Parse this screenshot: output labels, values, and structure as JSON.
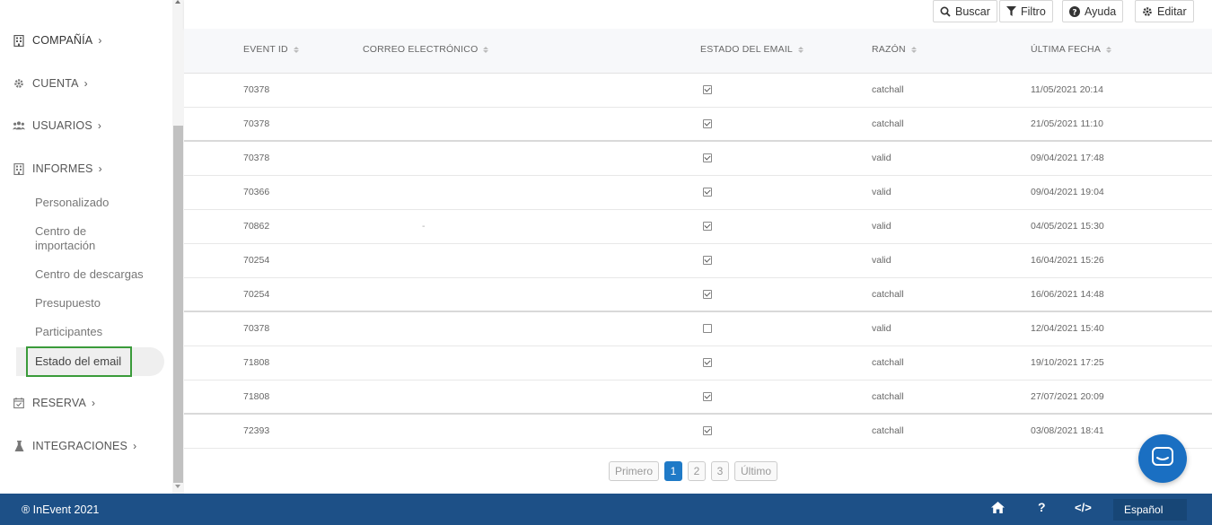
{
  "sidebar": {
    "sections": [
      {
        "label": "COMPAÑÍA",
        "icon": "building-icon"
      },
      {
        "label": "CUENTA",
        "icon": "gear-icon"
      },
      {
        "label": "USUARIOS",
        "icon": "users-icon"
      },
      {
        "label": "INFORMES",
        "icon": "building-icon"
      },
      {
        "label": "RESERVA",
        "icon": "calendar-check-icon"
      },
      {
        "label": "INTEGRACIONES",
        "icon": "flask-icon"
      }
    ],
    "chevron": "›",
    "report_items": [
      {
        "label": "Personalizado"
      },
      {
        "label": "Centro de\nimportación"
      },
      {
        "label": "Centro de descargas"
      },
      {
        "label": "Presupuesto"
      },
      {
        "label": "Participantes"
      },
      {
        "label": "Estado del email"
      }
    ]
  },
  "toolbar": {
    "search_label": "Buscar",
    "filter_label": "Filtro",
    "help_label": "Ayuda",
    "edit_label": "Editar"
  },
  "table": {
    "headers": [
      "EVENT ID",
      "CORREO ELECTRÓNICO",
      "ESTADO DEL EMAIL",
      "RAZÓN",
      "ÚLTIMA FECHA"
    ],
    "rows": [
      {
        "event_id": "70378",
        "email": "",
        "status": true,
        "reason": "catchall",
        "date": "11/05/2021 20:14"
      },
      {
        "event_id": "70378",
        "email": "",
        "status": true,
        "reason": "catchall",
        "date": "21/05/2021 11:10"
      },
      {
        "event_id": "70378",
        "email": "",
        "status": true,
        "reason": "valid",
        "date": "09/04/2021 17:48"
      },
      {
        "event_id": "70366",
        "email": "",
        "status": true,
        "reason": "valid",
        "date": "09/04/2021 19:04"
      },
      {
        "event_id": "70862",
        "email": "-",
        "status": true,
        "reason": "valid",
        "date": "04/05/2021 15:30"
      },
      {
        "event_id": "70254",
        "email": "",
        "status": true,
        "reason": "valid",
        "date": "16/04/2021 15:26"
      },
      {
        "event_id": "70254",
        "email": "",
        "status": true,
        "reason": "catchall",
        "date": "16/06/2021 14:48"
      },
      {
        "event_id": "70378",
        "email": "",
        "status": false,
        "reason": "valid",
        "date": "12/04/2021 15:40"
      },
      {
        "event_id": "71808",
        "email": "",
        "status": true,
        "reason": "catchall",
        "date": "19/10/2021 17:25"
      },
      {
        "event_id": "71808",
        "email": "",
        "status": true,
        "reason": "catchall",
        "date": "27/07/2021 20:09"
      },
      {
        "event_id": "72393",
        "email": "",
        "status": true,
        "reason": "catchall",
        "date": "03/08/2021 18:41"
      }
    ]
  },
  "pagination": {
    "first": "Primero",
    "pages": [
      "1",
      "2",
      "3"
    ],
    "current": "1",
    "last": "Último"
  },
  "footer": {
    "copyright": "® InEvent 2021",
    "language": "Español"
  },
  "colors": {
    "footer": "#1d5087",
    "accent": "#1f7ac7",
    "active_outline": "#3a9b3a"
  }
}
